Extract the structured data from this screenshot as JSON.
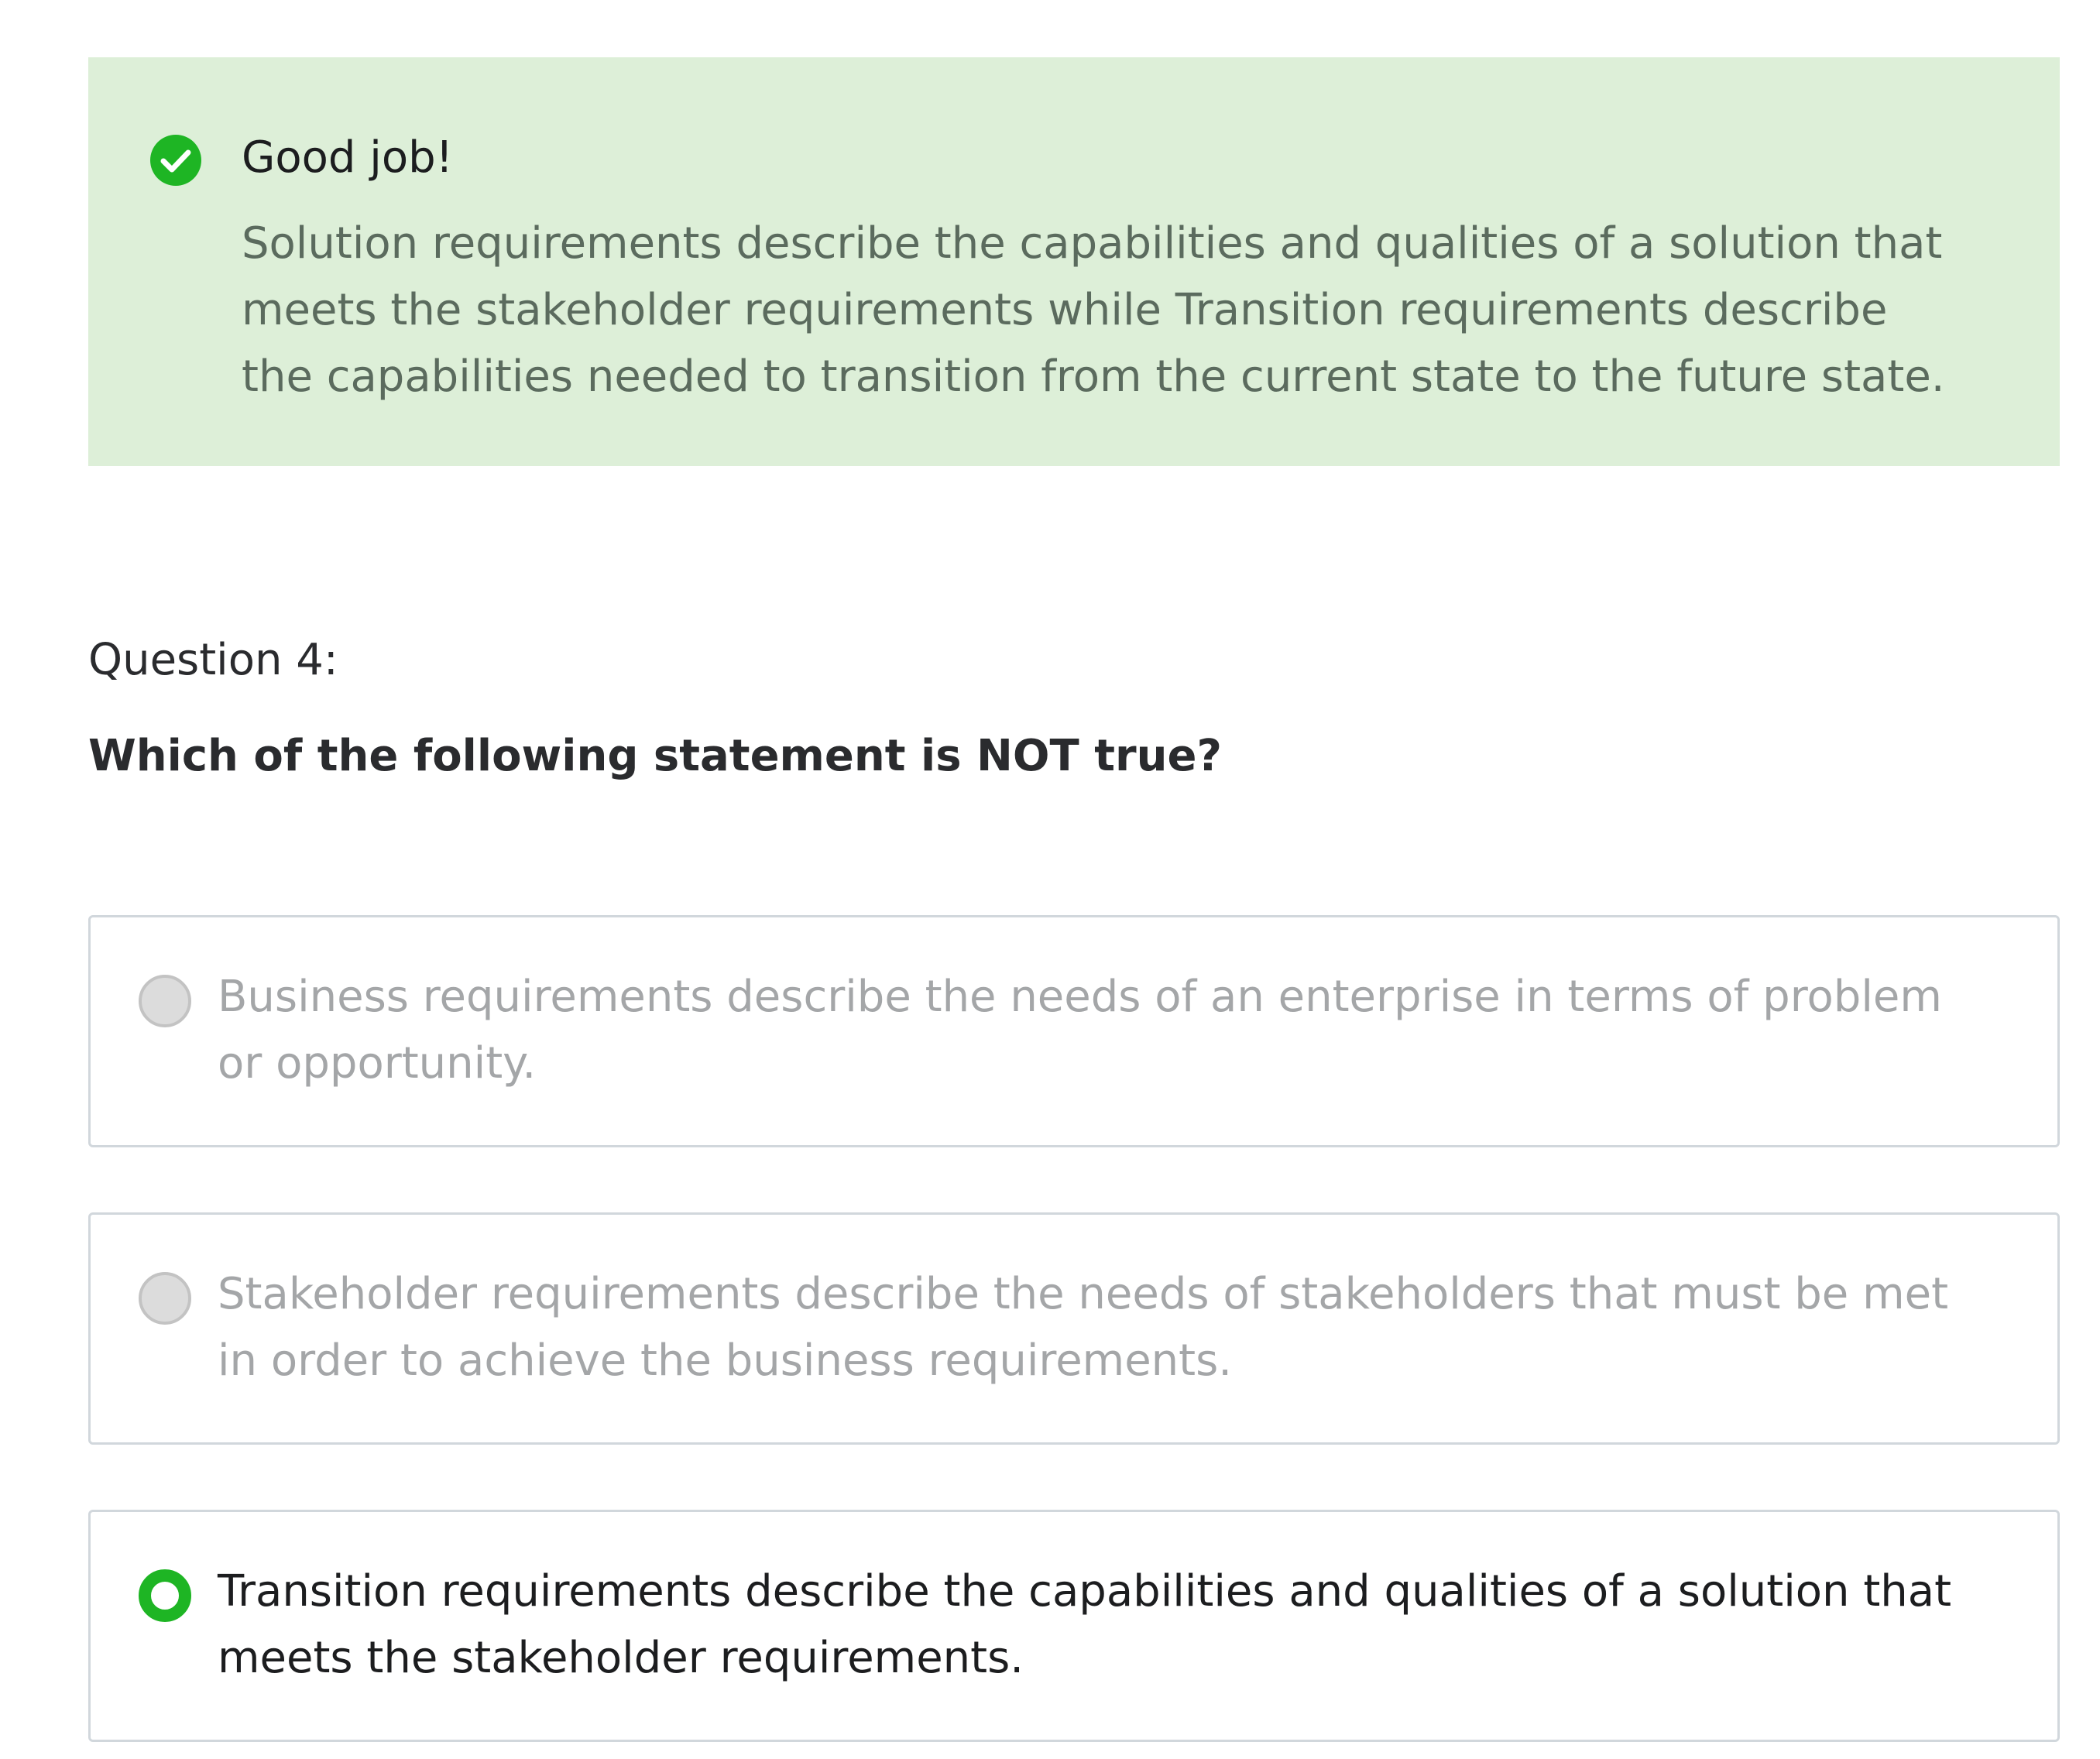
{
  "feedback": {
    "icon": "check-circle-icon",
    "status_color": "#1eb524",
    "title": "Good job!",
    "explanation_lines": [
      "Solution requirements describe the capabilities and qualities of a solution that",
      "meets the stakeholder requirements while Transition requirements describe",
      "the capabilities needed to transition from the current state to the future state."
    ]
  },
  "question": {
    "number_label": "Question 4:",
    "prompt": "Which of the following statement is NOT true?"
  },
  "options": [
    {
      "selected": false,
      "lines": [
        "Business requirements describe the needs of an enterprise in terms of problem",
        "or opportunity."
      ]
    },
    {
      "selected": false,
      "lines": [
        "Stakeholder requirements describe the needs of stakeholders that must be met",
        "in order to achieve the business requirements."
      ]
    },
    {
      "selected": true,
      "lines": [
        "Transition requirements describe the capabilities and qualities of a solution that",
        "meets the stakeholder requirements."
      ]
    }
  ]
}
